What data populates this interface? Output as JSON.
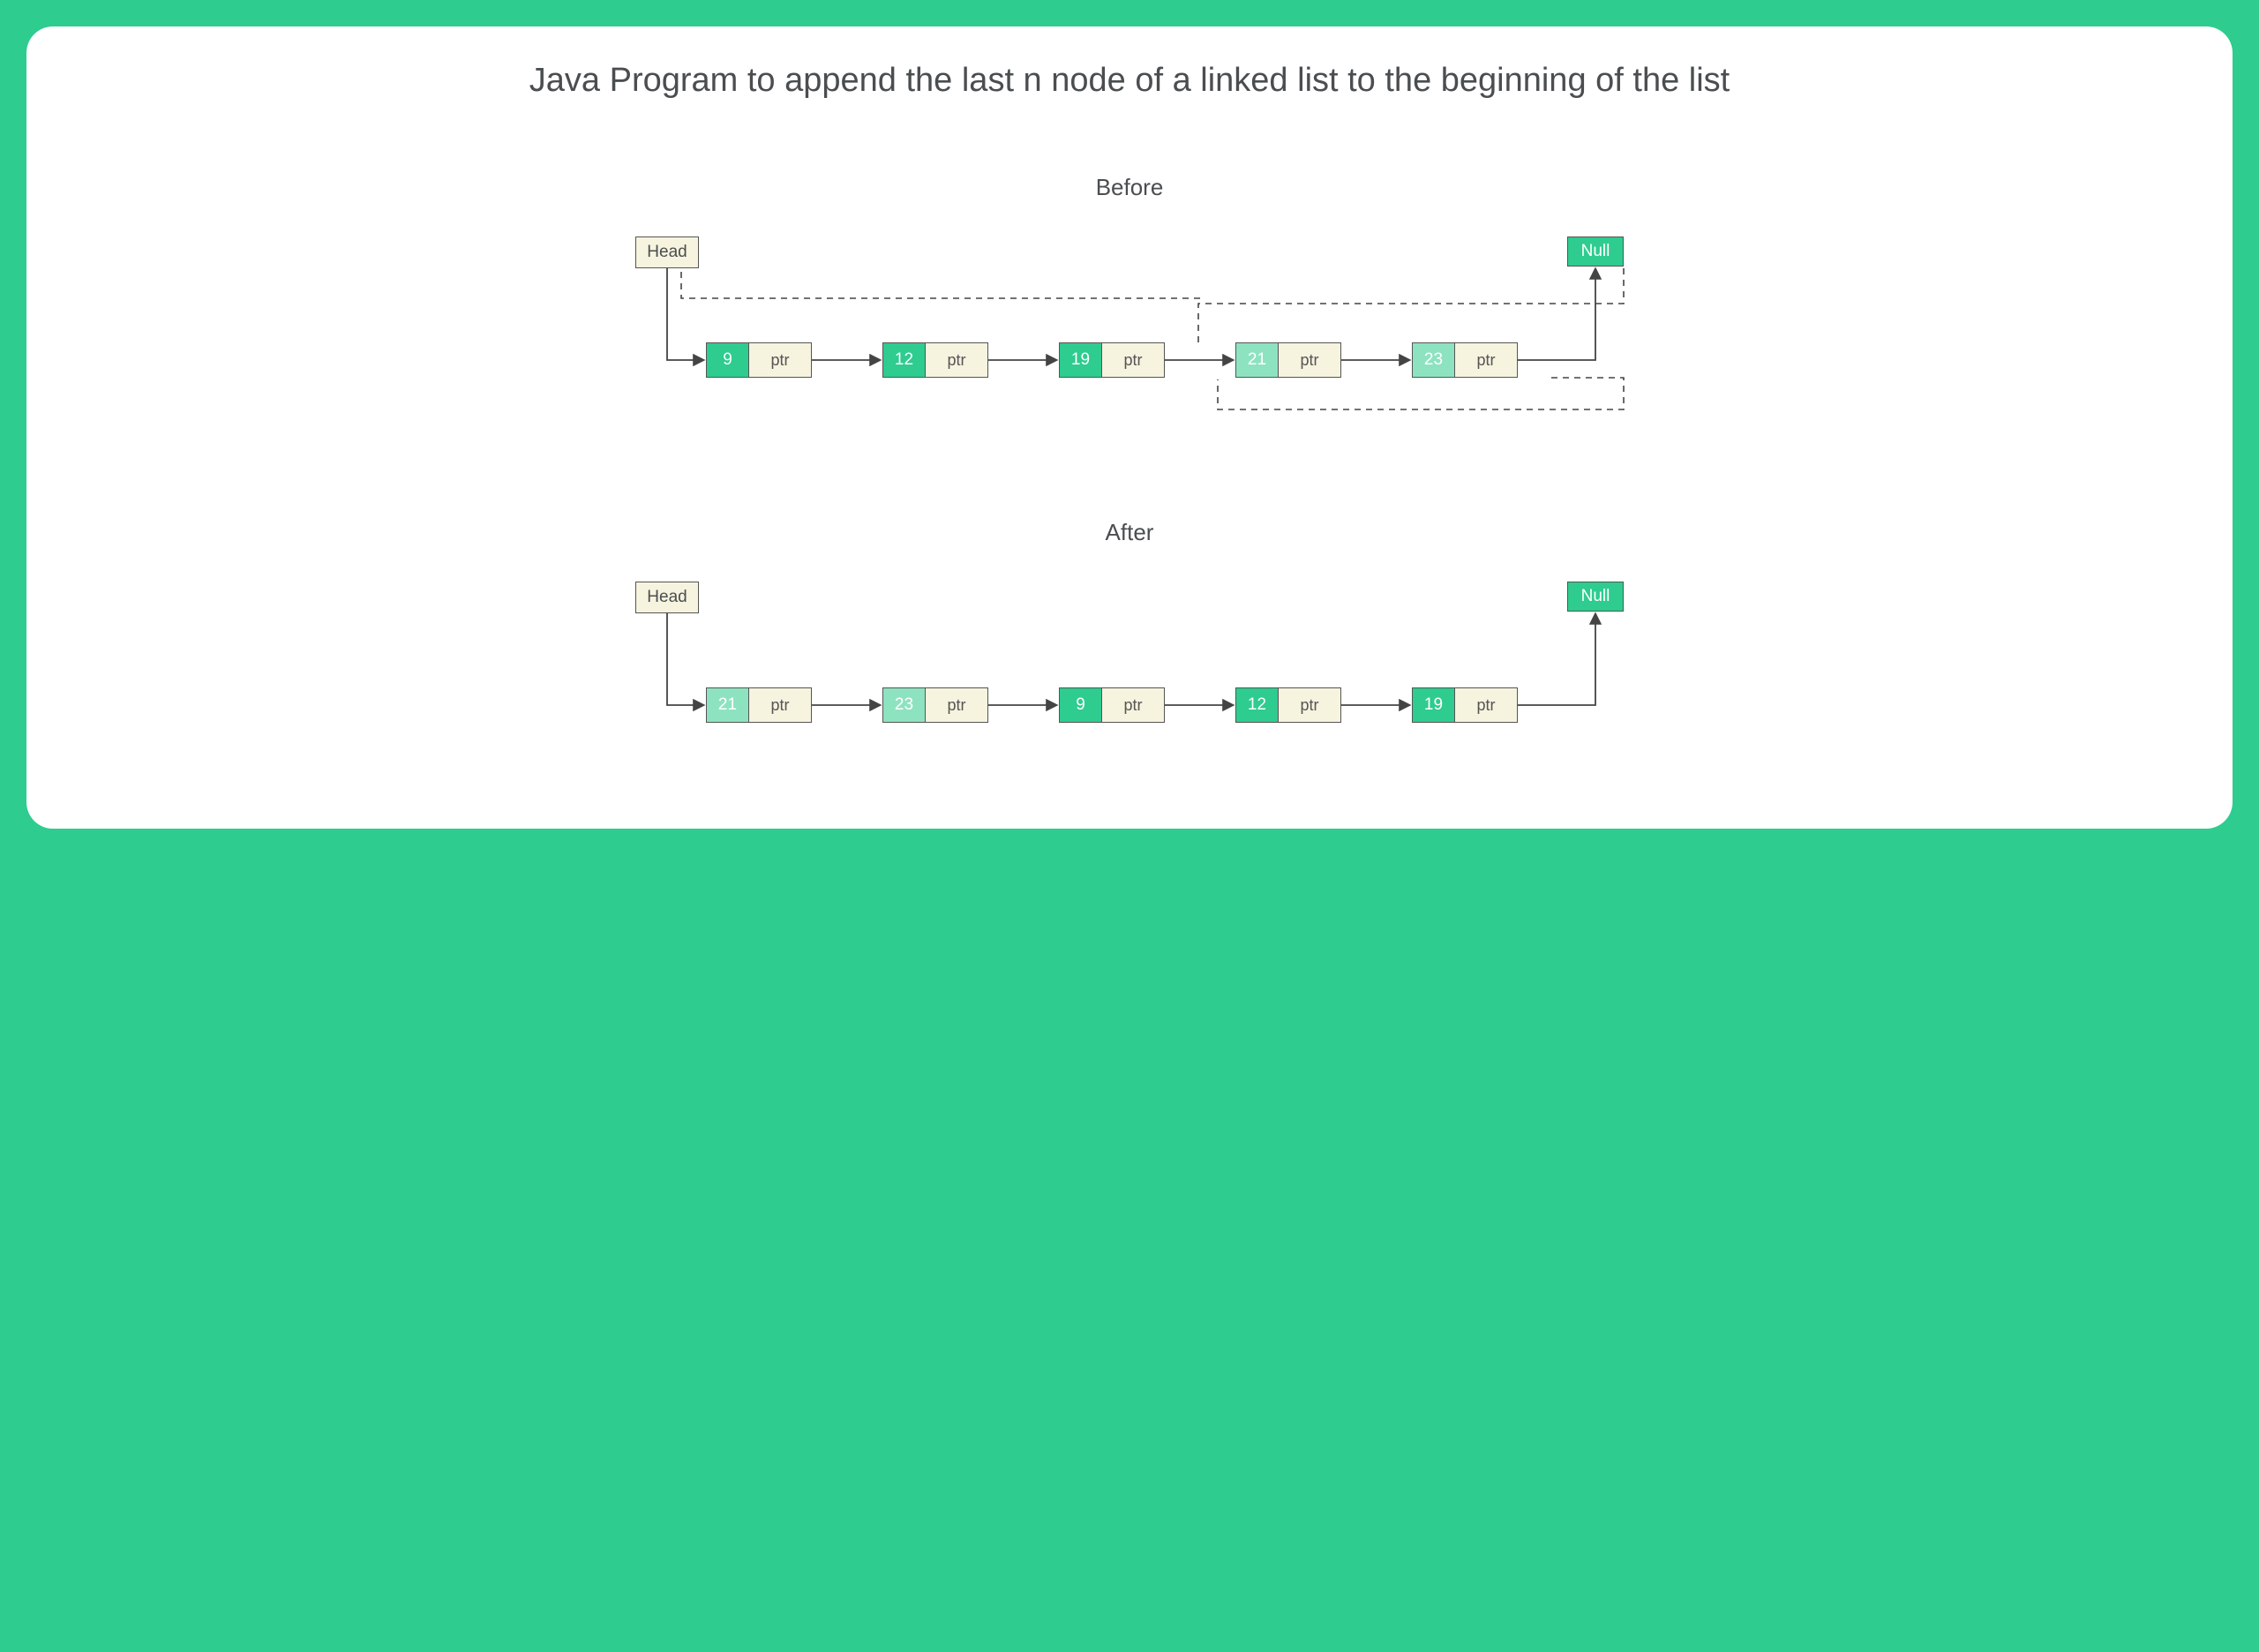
{
  "title": "Java Program to append the last n node of a linked list to the beginning of the list",
  "labels": {
    "before": "Before",
    "after": "After",
    "head": "Head",
    "null": "Null",
    "ptr": "ptr"
  },
  "before": {
    "nodes": [
      {
        "value": "9",
        "light": false
      },
      {
        "value": "12",
        "light": false
      },
      {
        "value": "19",
        "light": false
      },
      {
        "value": "21",
        "light": true
      },
      {
        "value": "23",
        "light": true
      }
    ]
  },
  "after": {
    "nodes": [
      {
        "value": "21",
        "light": true
      },
      {
        "value": "23",
        "light": true
      },
      {
        "value": "9",
        "light": false
      },
      {
        "value": "12",
        "light": false
      },
      {
        "value": "19",
        "light": false
      }
    ]
  },
  "colors": {
    "brand": "#2ECC8F",
    "brandLight": "#8de3c0",
    "cream": "#f6f3df",
    "text": "#4a4e50"
  }
}
